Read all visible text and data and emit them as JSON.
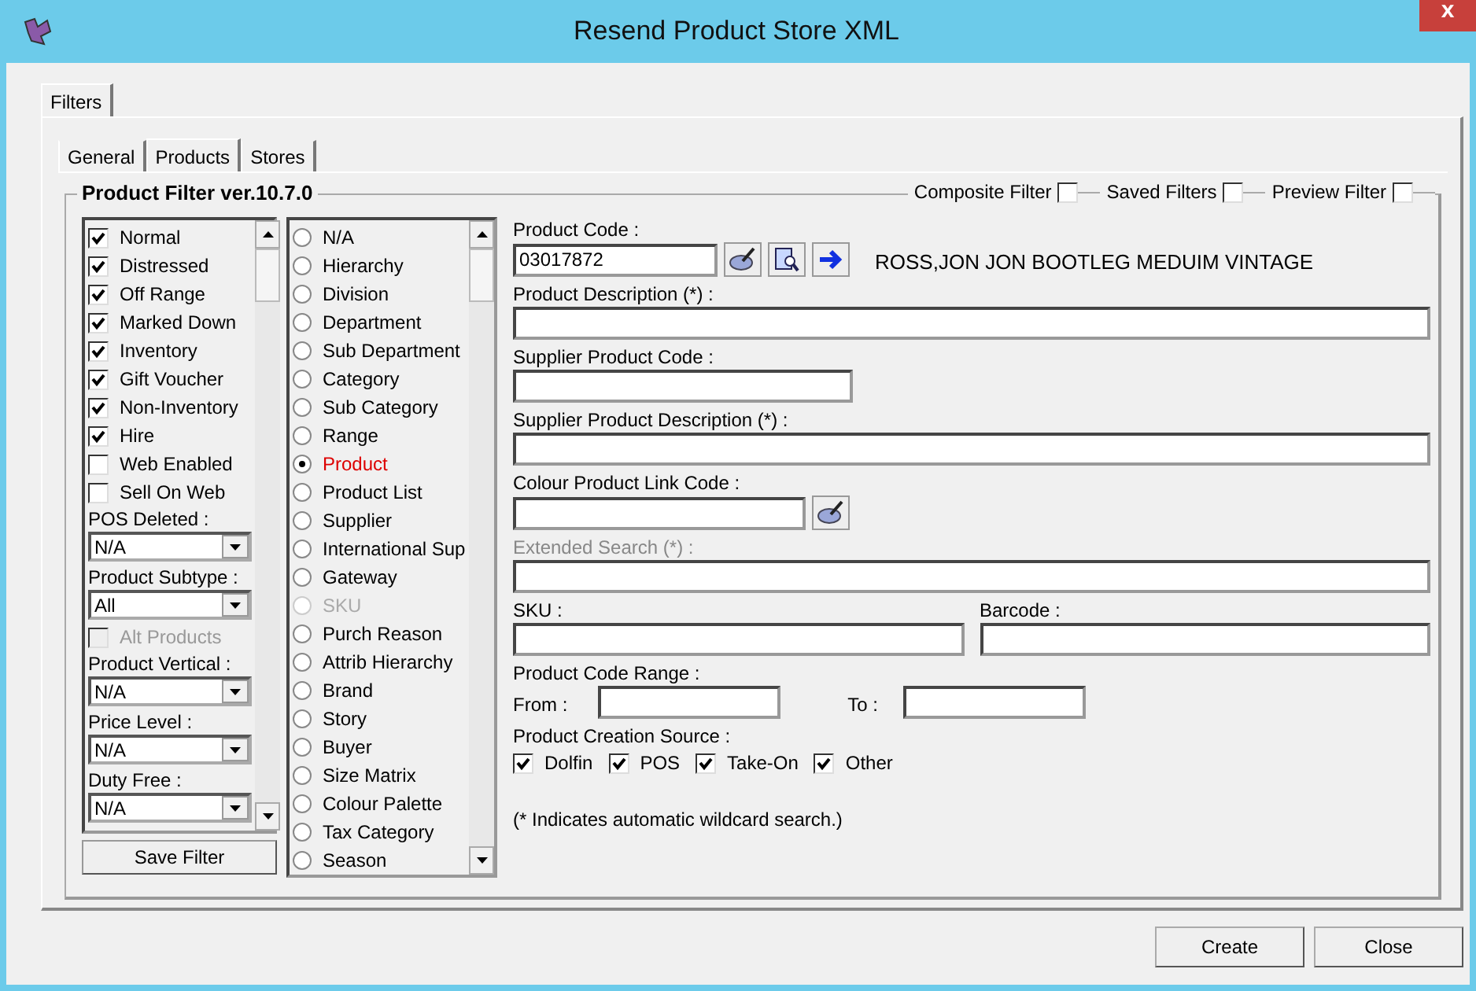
{
  "window": {
    "title": "Resend Product Store XML",
    "close_label": "x"
  },
  "outer_tabs": [
    {
      "label": "Filters",
      "selected": true
    }
  ],
  "inner_tabs": [
    {
      "label": "General",
      "selected": false
    },
    {
      "label": "Products",
      "selected": true
    },
    {
      "label": "Stores",
      "selected": false
    }
  ],
  "filter_group": {
    "title": "Product Filter ver.10.7.0",
    "options": [
      {
        "label": "Composite Filter",
        "checked": false
      },
      {
        "label": "Saved Filters",
        "checked": false
      },
      {
        "label": "Preview Filter",
        "checked": false
      }
    ]
  },
  "left_list": [
    {
      "kind": "checkbox",
      "label": "Normal",
      "checked": true,
      "disabled": false
    },
    {
      "kind": "checkbox",
      "label": "Distressed",
      "checked": true,
      "disabled": false
    },
    {
      "kind": "checkbox",
      "label": "Off Range",
      "checked": true,
      "disabled": false
    },
    {
      "kind": "checkbox",
      "label": "Marked Down",
      "checked": true,
      "disabled": false
    },
    {
      "kind": "checkbox",
      "label": "Inventory",
      "checked": true,
      "disabled": false
    },
    {
      "kind": "checkbox",
      "label": "Gift Voucher",
      "checked": true,
      "disabled": false
    },
    {
      "kind": "checkbox",
      "label": "Non-Inventory",
      "checked": true,
      "disabled": false
    },
    {
      "kind": "checkbox",
      "label": "Hire",
      "checked": true,
      "disabled": false
    },
    {
      "kind": "checkbox",
      "label": "Web Enabled",
      "checked": false,
      "disabled": false
    },
    {
      "kind": "checkbox",
      "label": "Sell On Web",
      "checked": false,
      "disabled": false
    },
    {
      "kind": "dropdown",
      "label": "POS Deleted :",
      "value": "N/A"
    },
    {
      "kind": "dropdown",
      "label": "Product Subtype :",
      "value": "All"
    },
    {
      "kind": "checkbox",
      "label": "Alt Products",
      "checked": false,
      "disabled": true
    },
    {
      "kind": "dropdown",
      "label": "Product Vertical :",
      "value": "N/A"
    },
    {
      "kind": "dropdown",
      "label": "Price Level :",
      "value": "N/A"
    },
    {
      "kind": "dropdown",
      "label": "Duty Free :",
      "value": "N/A"
    }
  ],
  "save_button": "Save Filter",
  "radio_list": [
    {
      "label": "N/A",
      "selected": false,
      "disabled": false
    },
    {
      "label": "Hierarchy",
      "selected": false,
      "disabled": false
    },
    {
      "label": "Division",
      "selected": false,
      "disabled": false
    },
    {
      "label": "Department",
      "selected": false,
      "disabled": false
    },
    {
      "label": "Sub Department",
      "selected": false,
      "disabled": false
    },
    {
      "label": "Category",
      "selected": false,
      "disabled": false
    },
    {
      "label": "Sub Category",
      "selected": false,
      "disabled": false
    },
    {
      "label": "Range",
      "selected": false,
      "disabled": false
    },
    {
      "label": "Product",
      "selected": true,
      "disabled": false
    },
    {
      "label": "Product List",
      "selected": false,
      "disabled": false
    },
    {
      "label": "Supplier",
      "selected": false,
      "disabled": false
    },
    {
      "label": "International Sup",
      "selected": false,
      "disabled": false
    },
    {
      "label": "Gateway",
      "selected": false,
      "disabled": false
    },
    {
      "label": "SKU",
      "selected": false,
      "disabled": true
    },
    {
      "label": "Purch Reason",
      "selected": false,
      "disabled": false
    },
    {
      "label": "Attrib Hierarchy",
      "selected": false,
      "disabled": false
    },
    {
      "label": "Brand",
      "selected": false,
      "disabled": false
    },
    {
      "label": "Story",
      "selected": false,
      "disabled": false
    },
    {
      "label": "Buyer",
      "selected": false,
      "disabled": false
    },
    {
      "label": "Size Matrix",
      "selected": false,
      "disabled": false
    },
    {
      "label": "Colour Palette",
      "selected": false,
      "disabled": false
    },
    {
      "label": "Tax Category",
      "selected": false,
      "disabled": false
    },
    {
      "label": "Season",
      "selected": false,
      "disabled": false
    }
  ],
  "form": {
    "product_code": {
      "label": "Product Code :",
      "value": "03017872",
      "description": "ROSS,JON JON BOOTLEG MEDUIM VINTAGE"
    },
    "product_description": {
      "label": "Product Description (*) :"
    },
    "supplier_product_code": {
      "label": "Supplier Product Code :"
    },
    "supplier_product_description": {
      "label": "Supplier Product Description (*) :"
    },
    "colour_product_link_code": {
      "label": "Colour Product Link Code :"
    },
    "extended_search": {
      "label": "Extended Search (*) :",
      "disabled": true
    },
    "sku": {
      "label": "SKU :"
    },
    "barcode": {
      "label": "Barcode :"
    },
    "code_range": {
      "label": "Product Code Range :",
      "from": "From :",
      "to": "To :"
    },
    "creation_source": {
      "label": "Product Creation Source :",
      "options": [
        {
          "label": "Dolfin",
          "checked": true
        },
        {
          "label": "POS",
          "checked": true
        },
        {
          "label": "Take-On",
          "checked": true
        },
        {
          "label": "Other",
          "checked": true
        }
      ]
    },
    "note": "(* Indicates automatic wildcard search.)"
  },
  "buttons": [
    "Create",
    "Close"
  ]
}
